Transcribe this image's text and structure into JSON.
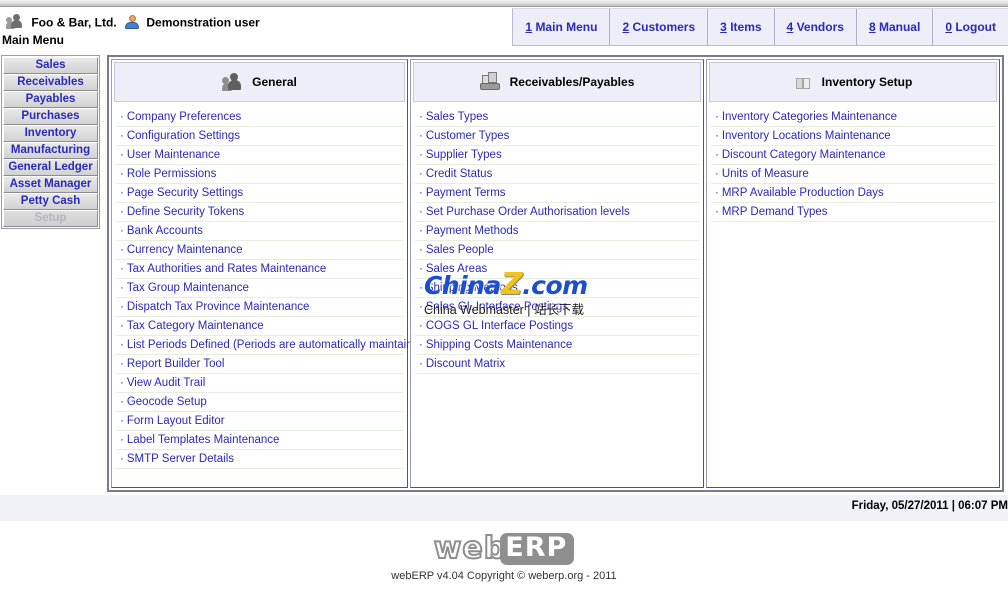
{
  "header": {
    "company_name": "Foo & Bar, Ltd.",
    "user_name": "Demonstration user",
    "page_title": "Main Menu",
    "company_icon": "group-people-icon",
    "user_icon": "user-avatar-icon"
  },
  "topnav": [
    {
      "accel": "1",
      "label": "Main Menu"
    },
    {
      "accel": "2",
      "label": "Customers"
    },
    {
      "accel": "3",
      "label": "Items"
    },
    {
      "accel": "4",
      "label": "Vendors"
    },
    {
      "accel": "8",
      "label": "Manual"
    },
    {
      "accel": "0",
      "label": "Logout"
    }
  ],
  "sidebar": {
    "items": [
      {
        "label": "Sales",
        "active": false
      },
      {
        "label": "Receivables",
        "active": false
      },
      {
        "label": "Payables",
        "active": false
      },
      {
        "label": "Purchases",
        "active": false
      },
      {
        "label": "Inventory",
        "active": false
      },
      {
        "label": "Manufacturing",
        "active": false
      },
      {
        "label": "General Ledger",
        "active": false
      },
      {
        "label": "Asset Manager",
        "active": false
      },
      {
        "label": "Petty Cash",
        "active": false
      },
      {
        "label": "Setup",
        "active": true
      }
    ]
  },
  "columns": [
    {
      "title": "General",
      "icon": "group-people-icon",
      "links": [
        "Company Preferences",
        "Configuration Settings",
        "User Maintenance",
        "Role Permissions",
        "Page Security Settings",
        "Define Security Tokens",
        "Bank Accounts",
        "Currency Maintenance",
        "Tax Authorities and Rates Maintenance",
        "Tax Group Maintenance",
        "Dispatch Tax Province Maintenance",
        "Tax Category Maintenance",
        "List Periods Defined (Periods are automatically maintained)",
        "Report Builder Tool",
        "View Audit Trail",
        "Geocode Setup",
        "Form Layout Editor",
        "Label Templates Maintenance",
        "SMTP Server Details"
      ]
    },
    {
      "title": "Receivables/Payables",
      "icon": "money-stack-icon",
      "links": [
        "Sales Types",
        "Customer Types",
        "Supplier Types",
        "Credit Status",
        "Payment Terms",
        "Set Purchase Order Authorisation levels",
        "Payment Methods",
        "Sales People",
        "Sales Areas",
        "Shipping Methods",
        "Sales GL Interface Postings",
        "COGS GL Interface Postings",
        "Shipping Costs Maintenance",
        "Discount Matrix"
      ]
    },
    {
      "title": "Inventory Setup",
      "icon": "cube-box-icon",
      "links": [
        "Inventory Categories Maintenance",
        "Inventory Locations Maintenance",
        "Discount Category Maintenance",
        "Units of Measure",
        "MRP Available Production Days",
        "MRP Demand Types"
      ]
    }
  ],
  "watermark": {
    "brand_prefix": "China",
    "brand_z": "Z",
    "brand_suffix": ".com",
    "subtitle": "China Webmaster | 站长下载"
  },
  "status": {
    "datetime": "Friday, 05/27/2011 | 06:07 PM"
  },
  "footer": {
    "logo_web": "web",
    "logo_erp": "ERP",
    "copyright": "webERP v4.04 Copyright © weberp.org - 2011"
  },
  "colors": {
    "link": "#2a2ab8",
    "panel_header_bg": "#eeeef8",
    "row_divider": "#e3f0dd",
    "watermark_blue": "#1c4fd0",
    "watermark_yellow": "#f0c419"
  }
}
